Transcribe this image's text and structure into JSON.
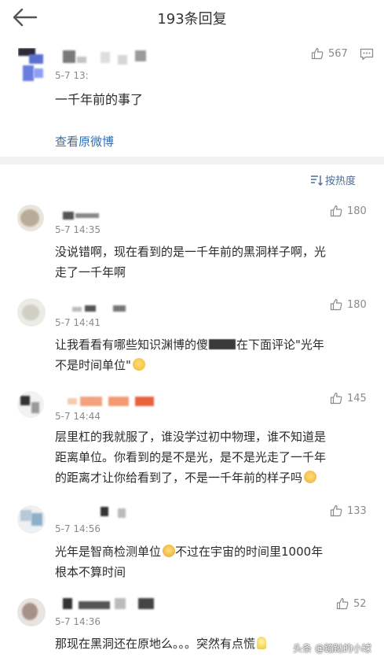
{
  "header": {
    "title": "193条回复"
  },
  "main_comment": {
    "time": "5-7 13:",
    "likes": "567",
    "text": "一千年前的事了",
    "view_original": "查看原微博"
  },
  "sort": {
    "label": "按热度"
  },
  "replies": [
    {
      "time": "5-7 14:35",
      "likes": "180",
      "lines": [
        "没说错啊，现在看到的是一千年前的黑洞样子啊，光",
        "走了一千年啊"
      ]
    },
    {
      "time": "5-7 14:41",
      "likes": "180",
      "line1_a": "让我看看有哪些知识渊博的傻",
      "line1_b": "在下面评论\"光年",
      "line2": "不是时间单位\""
    },
    {
      "time": "5-7 14:44",
      "likes": "145",
      "lines": [
        "层里杠的我就服了，谁没学过初中物理，谁不知道是",
        "距离单位。你看到的是不是光，是不是光走了一千年",
        "的距离才让你给看到了，不是一千年前的样子吗"
      ]
    },
    {
      "time": "5-7 14:56",
      "likes": "133",
      "line1_a": "光年是智商检测单位",
      "line1_b": "不过在宇宙的时间里1000年",
      "line2": "根本不算时间"
    },
    {
      "time": "5-7 14:36",
      "likes": "52",
      "line1": "那现在黑洞还在原地么。。。突然有点慌"
    }
  ],
  "watermark": "头条 @蹦跶的小球",
  "colors": {
    "link": "#2f6fb6",
    "sort": "#4f6c93",
    "muted": "#8a8a8a",
    "divider": "#f2f2f2"
  }
}
